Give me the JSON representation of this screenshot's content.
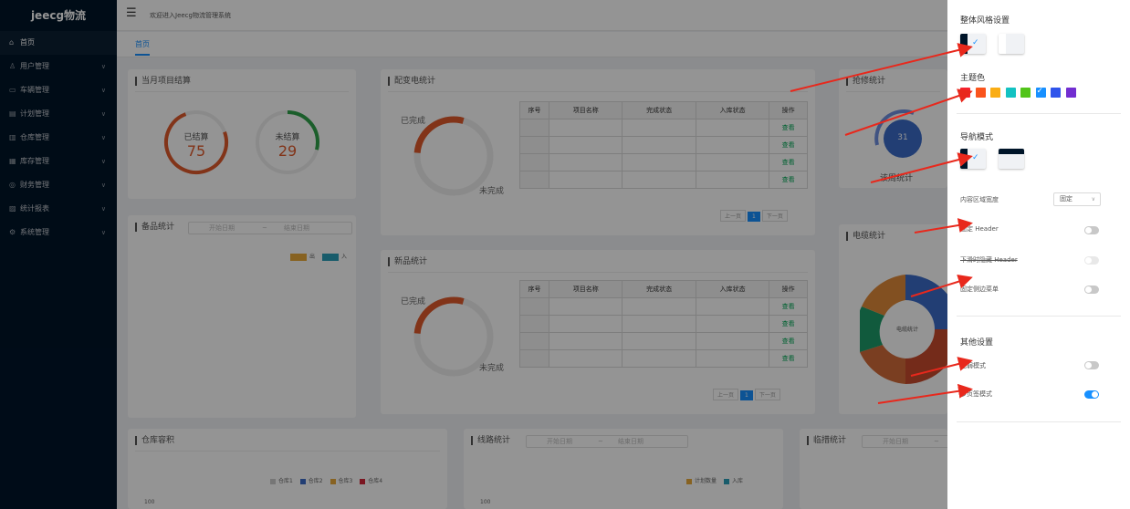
{
  "sidebar": {
    "logo": "jeecg物流",
    "items": [
      {
        "icon": "⌂",
        "label": "首页",
        "chevron": false
      },
      {
        "icon": "♙",
        "label": "用户管理",
        "chevron": true
      },
      {
        "icon": "▭",
        "label": "车辆管理",
        "chevron": true
      },
      {
        "icon": "▤",
        "label": "计划管理",
        "chevron": true
      },
      {
        "icon": "▥",
        "label": "仓库管理",
        "chevron": true
      },
      {
        "icon": "▦",
        "label": "库存管理",
        "chevron": true
      },
      {
        "icon": "◎",
        "label": "财务管理",
        "chevron": true
      },
      {
        "icon": "▨",
        "label": "统计报表",
        "chevron": true
      },
      {
        "icon": "⚙",
        "label": "系统管理",
        "chevron": true
      }
    ]
  },
  "topbar": {
    "welcome": "欢迎进入Jeecg物流管理系统"
  },
  "tabs": {
    "home": "首页"
  },
  "cards": {
    "settlement": {
      "title": "当月项目结算",
      "settled_label": "已结算",
      "settled_value": "75",
      "unsettled_label": "未结算",
      "unsettled_value": "29"
    },
    "delivery": {
      "title": "配变电统计",
      "done": "已完成",
      "undone": "未完成"
    },
    "repair": {
      "title": "抢修统计",
      "value": "31",
      "caption": "该周统计"
    },
    "spare": {
      "title": "备品统计",
      "start": "开始日期",
      "sep": "~",
      "end": "结束日期",
      "legend_out": "出",
      "legend_in": "入"
    },
    "newproduct": {
      "title": "新品统计",
      "done": "已完成",
      "undone": "未完成"
    },
    "cable": {
      "title": "电缆统计",
      "center": "电缆统计"
    },
    "warehouse": {
      "title": "仓库容积",
      "legends": [
        "仓库1",
        "仓库2",
        "仓库3",
        "仓库4"
      ],
      "y100": "100"
    },
    "route": {
      "title": "线路统计",
      "start": "开始日期",
      "sep": "~",
      "end": "结束日期",
      "legends": [
        "计划数量",
        "入库"
      ],
      "y100": "100"
    },
    "temp": {
      "title": "临措统计",
      "start": "开始日期",
      "sep": "~"
    }
  },
  "table": {
    "headers": [
      "序号",
      "项目名称",
      "完成状态",
      "入库状态",
      "操作"
    ],
    "action": "查看",
    "prev": "上一页",
    "page": "1",
    "next": "下一页"
  },
  "table2": {
    "headers": [
      "序号",
      "项目名称",
      "完成状态",
      "入库状态",
      "操作"
    ]
  },
  "drawer": {
    "style_title": "整体风格设置",
    "theme_title": "主题色",
    "theme_colors": [
      "#f5222d",
      "#fa541c",
      "#faad14",
      "#13c2c2",
      "#52c41a",
      "#1890ff",
      "#2f54eb",
      "#722ed1"
    ],
    "nav_title": "导航模式",
    "content_width_label": "内容区域宽度",
    "content_width_value": "固定",
    "fixed_header": "固定 Header",
    "hide_header": "下滑时隐藏 Header",
    "fixed_sidebar": "固定侧边菜单",
    "other_title": "其他设置",
    "weak_mode": "色弱模式",
    "multi_tab": "多页签模式",
    "toggles": {
      "fixed_header": false,
      "hide_header": false,
      "fixed_sidebar": false,
      "weak_mode": false,
      "multi_tab": true
    }
  },
  "colors": {
    "accent": "#1890ff",
    "sidebar_bg": "#001529",
    "arrow": "#e8281c",
    "settled": "#e05a2b",
    "unsettled": "#2fa34a"
  }
}
